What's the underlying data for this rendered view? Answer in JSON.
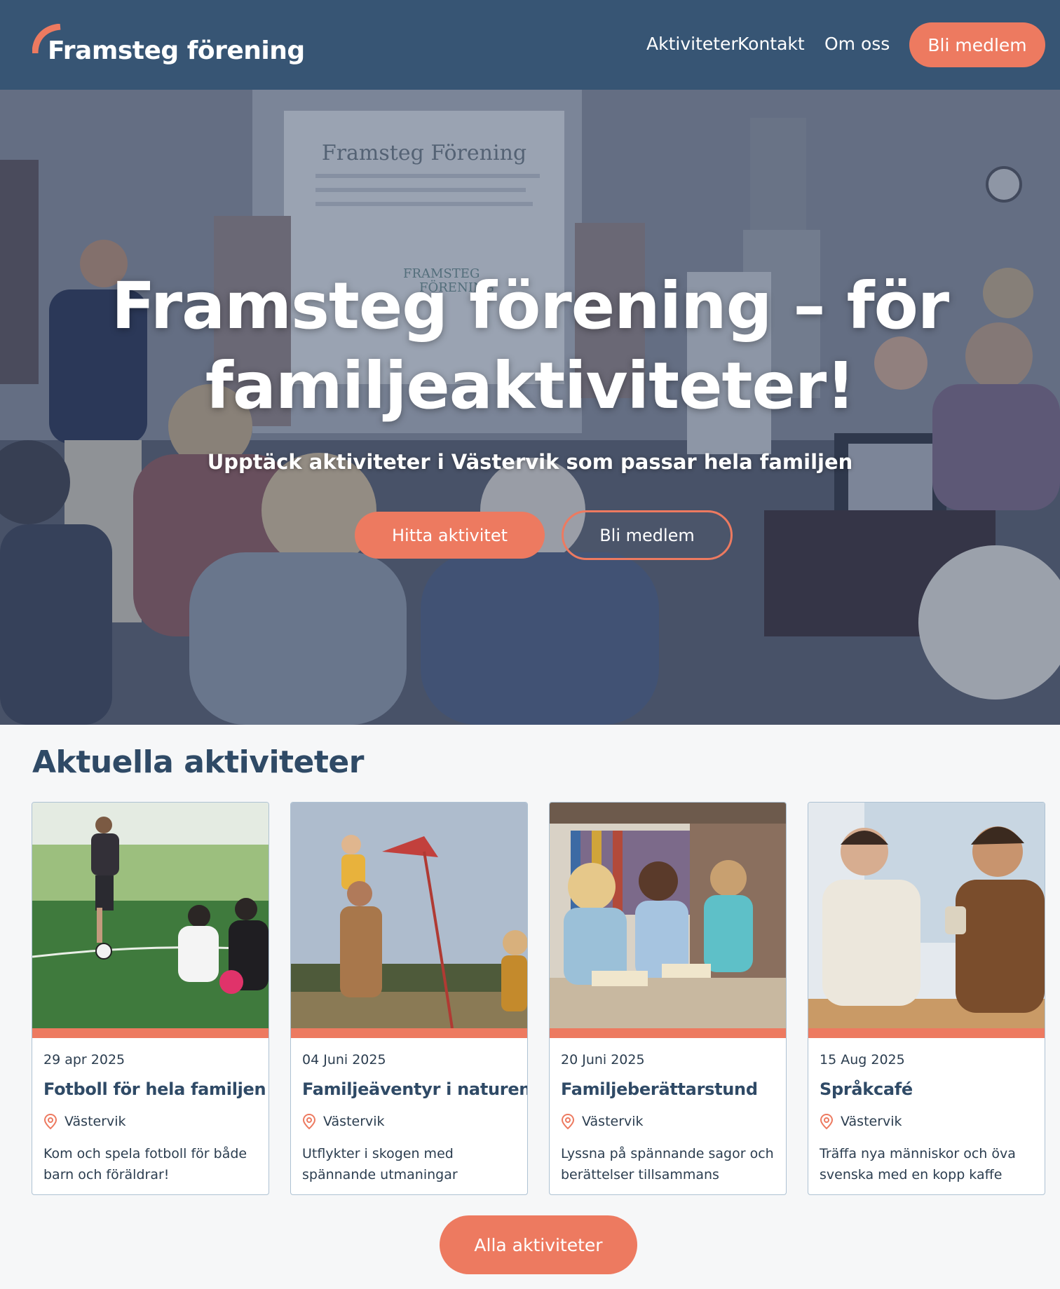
{
  "header": {
    "logo_text": "Framsteg förening",
    "nav": [
      "Aktiviteter",
      "Kontakt",
      "Om oss"
    ],
    "cta": "Bli medlem"
  },
  "hero": {
    "title": "Framsteg förening – för familjeaktiviteter!",
    "subtitle": "Upptäck aktiviteter i Västervik som passar hela familjen",
    "primary_button": "Hitta aktivitet",
    "secondary_button": "Bli medlem",
    "slide_title": "Framsteg Förening",
    "slide_logo_line1": "FRAMSTEG",
    "slide_logo_line2": "FÖRENING"
  },
  "activities": {
    "heading": "Aktuella aktiviteter",
    "cards": [
      {
        "date": "29 apr 2025",
        "title": "Fotboll för hela familjen",
        "location": "Västervik",
        "description": "Kom och spela fotboll för både barn och föräldrar!"
      },
      {
        "date": "04 Juni 2025",
        "title": "Familjeäventyr i naturen",
        "location": "Västervik",
        "description": "Utflykter i skogen med spännande utmaningar"
      },
      {
        "date": "20 Juni 2025",
        "title": "Familjeberättarstund",
        "location": "Västervik",
        "description": "Lyssna på spännande sagor och berättelser tillsammans"
      },
      {
        "date": "15 Aug 2025",
        "title": "Språkcafé",
        "location": "Västervik",
        "description": "Träffa nya människor och öva svenska med en kopp kaffe"
      }
    ],
    "all_button": "Alla aktiviteter"
  },
  "colors": {
    "header_bg": "#375574",
    "accent": "#ed7a60",
    "heading": "#2f4a66",
    "page_bg": "#f6f7f8"
  }
}
